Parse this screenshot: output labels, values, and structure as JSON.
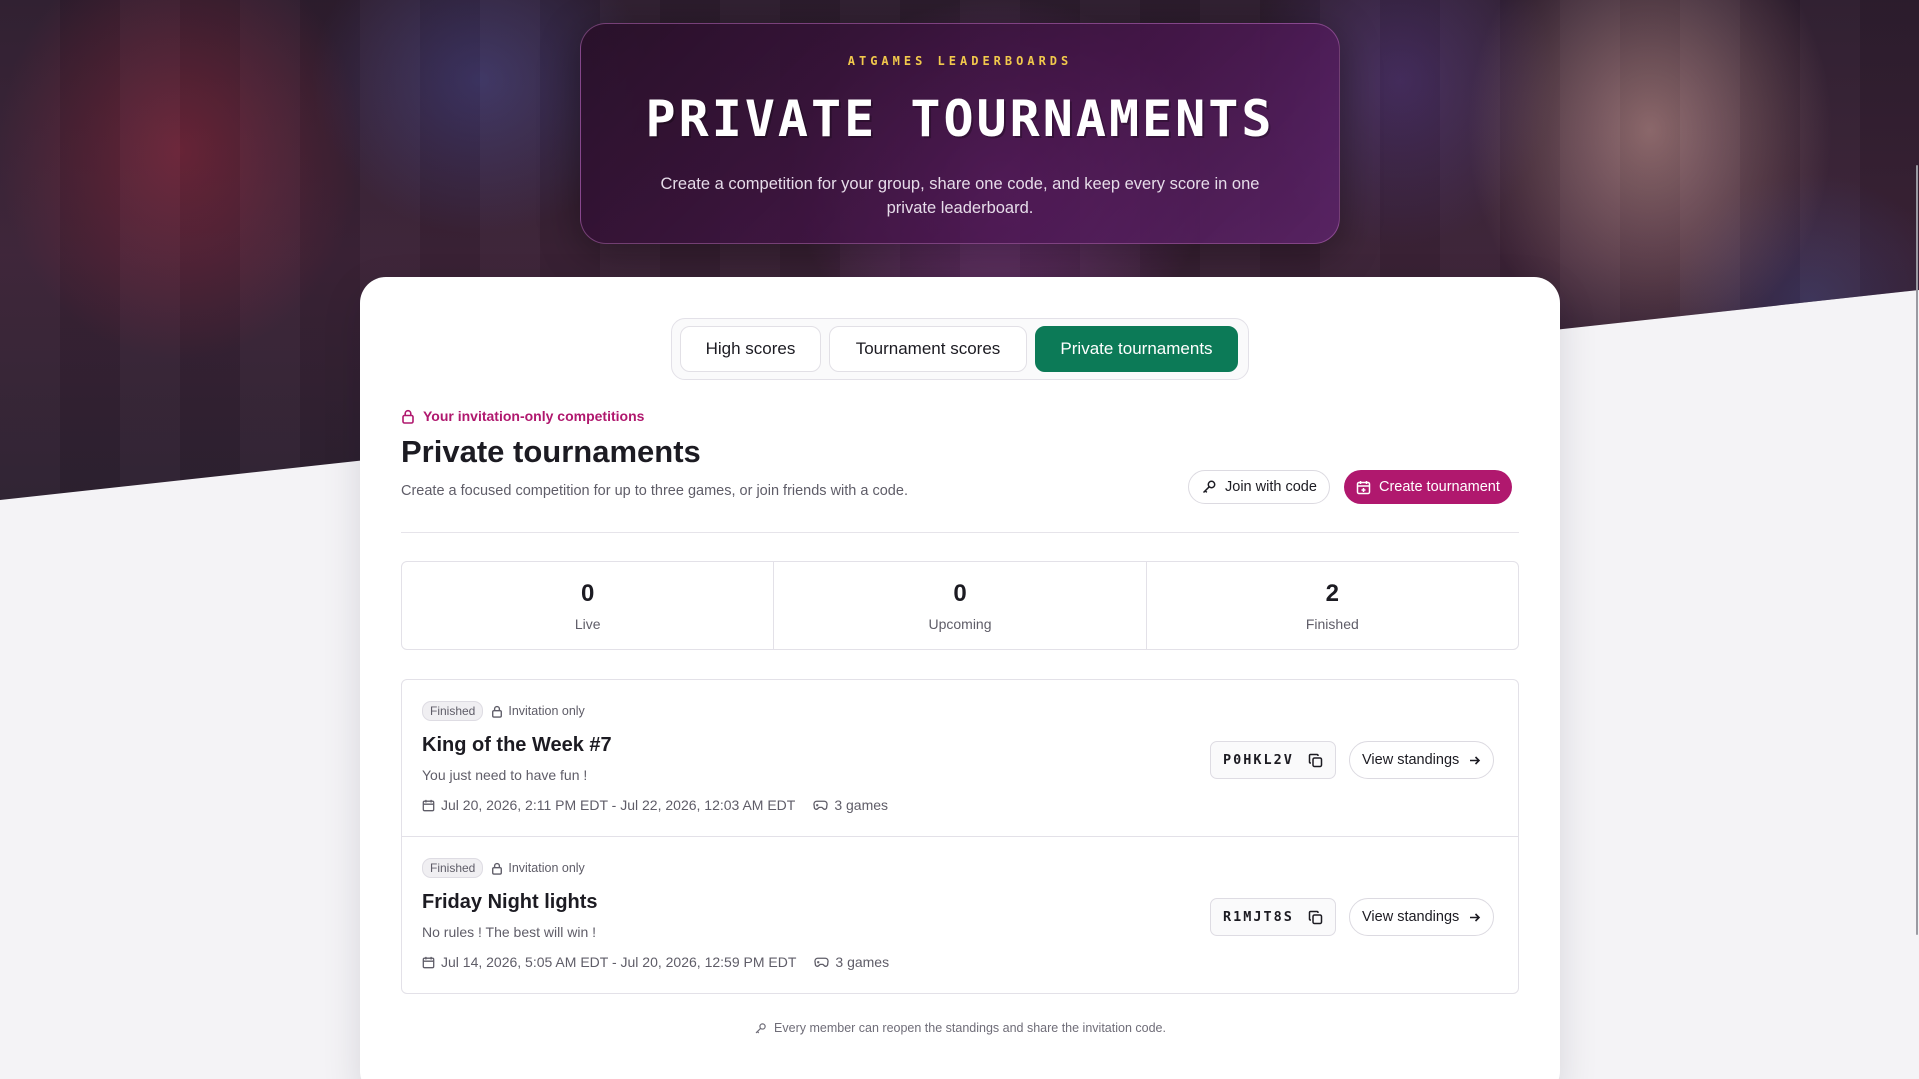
{
  "hero": {
    "eyebrow": "ATGAMES LEADERBOARDS",
    "title": "PRIVATE TOURNAMENTS",
    "subtitle": "Create a competition for your group, share one code, and keep every score in one private leaderboard."
  },
  "tabs": [
    {
      "label": "High scores",
      "active": false
    },
    {
      "label": "Tournament scores",
      "active": false
    },
    {
      "label": "Private tournaments",
      "active": true
    }
  ],
  "section": {
    "eyebrow": "Your invitation-only competitions",
    "title": "Private tournaments",
    "description": "Create a focused competition for up to three games, or join friends with a code.",
    "join_label": "Join with code",
    "create_label": "Create tournament"
  },
  "stats": [
    {
      "value": "0",
      "label": "Live"
    },
    {
      "value": "0",
      "label": "Upcoming"
    },
    {
      "value": "2",
      "label": "Finished"
    }
  ],
  "tournaments": [
    {
      "status": "Finished",
      "visibility": "Invitation only",
      "title": "King of the Week #7",
      "description": "You just need to have fun !",
      "dates": "Jul 20, 2026, 2:11 PM EDT - Jul 22, 2026, 12:03 AM EDT",
      "games": "3 games",
      "code": "P0HKL2V",
      "view_label": "View standings"
    },
    {
      "status": "Finished",
      "visibility": "Invitation only",
      "title": "Friday Night lights",
      "description": "No rules ! The best will win !",
      "dates": "Jul 14, 2026, 5:05 AM EDT - Jul 20, 2026, 12:59 PM EDT",
      "games": "3 games",
      "code": "R1MJT8S",
      "view_label": "View standings"
    }
  ],
  "footer_note": "Every member can reopen the standings and share the invitation code.",
  "colors": {
    "brand": "#b0186e",
    "active_tab": "#0c7a57",
    "eyebrow_gold": "#f2c94c"
  }
}
